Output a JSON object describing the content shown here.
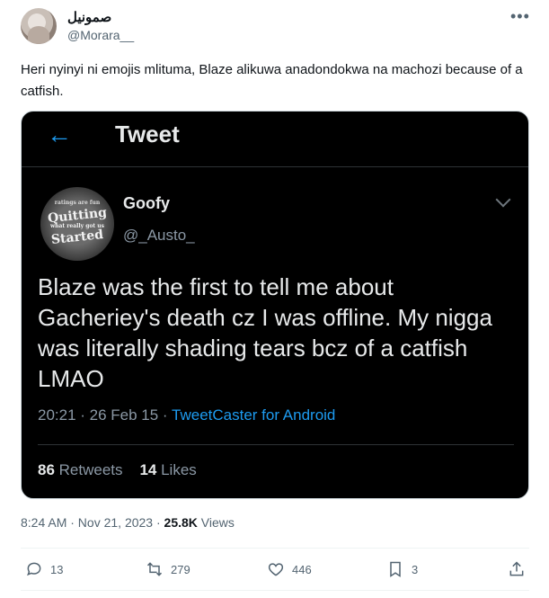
{
  "author": {
    "display_name": "صمونيل",
    "handle": "@Morara__"
  },
  "tweet": {
    "text": "Heri nyinyi ni emojis mlituma, Blaze alikuwa anadondokwa na machozi because of a catfish."
  },
  "embedded": {
    "header_title": "Tweet",
    "avatar_text": [
      "ratings are fun",
      "Quitting",
      "what really got us",
      "Started"
    ],
    "name": "Goofy",
    "handle": "@_Austo_",
    "body": "Blaze was the first to tell me about Gacheriey's death cz I was offline. My nigga was literally shading tears bcz of a catfish LMAO",
    "time": "20:21 · 26 Feb 15 · ",
    "client": "TweetCaster for Android",
    "retweets_count": "86",
    "retweets_label": "Retweets",
    "likes_count": "14",
    "likes_label": "Likes"
  },
  "meta": {
    "timestamp": "8:24 AM · Nov 21, 2023 · ",
    "views_count": "25.8K",
    "views_label": " Views"
  },
  "actions": {
    "replies": "13",
    "retweets": "279",
    "likes": "446",
    "bookmarks": "3"
  },
  "colors": {
    "accent": "#1d9bf0",
    "secondary_text": "#536471"
  },
  "icons": {
    "back": "arrow-left-icon",
    "more": "more-horizontal-icon",
    "reply": "reply-icon",
    "retweet": "retweet-icon",
    "like": "heart-icon",
    "bookmark": "bookmark-icon",
    "share": "share-icon"
  }
}
